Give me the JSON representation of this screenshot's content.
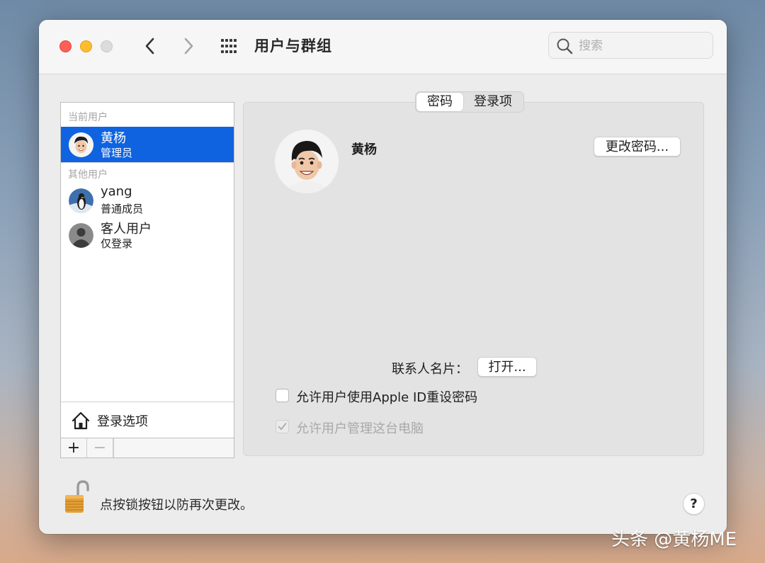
{
  "window": {
    "title": "用户与群组"
  },
  "search": {
    "placeholder": "搜索"
  },
  "userlist": {
    "current_label": "当前用户",
    "other_label": "其他用户",
    "current_user": {
      "name": "黄杨",
      "role": "管理员"
    },
    "others": [
      {
        "name": "yang",
        "role": "普通成员"
      },
      {
        "name": "客人用户",
        "role": "仅登录"
      }
    ],
    "login_options": "登录选项",
    "add_symbol": "+",
    "remove_symbol": "−"
  },
  "tabs": [
    {
      "label": "密码",
      "active": true
    },
    {
      "label": "登录项",
      "active": false
    }
  ],
  "profile": {
    "name": "黄杨",
    "change_password": "更改密码..."
  },
  "contact": {
    "label": "联系人名片：",
    "open_button": "打开..."
  },
  "options": [
    {
      "label": "允许用户使用Apple ID重设密码",
      "checked": false,
      "disabled": false
    },
    {
      "label": "允许用户管理这台电脑",
      "checked": true,
      "disabled": true
    }
  ],
  "footer": {
    "lock_text": "点按锁按钮以防再次更改。",
    "help": "?"
  },
  "watermark": "头条 @黄杨ME",
  "colors": {
    "selection": "#0f63e0",
    "close": "#fe5f57",
    "minimize": "#febc2e"
  }
}
